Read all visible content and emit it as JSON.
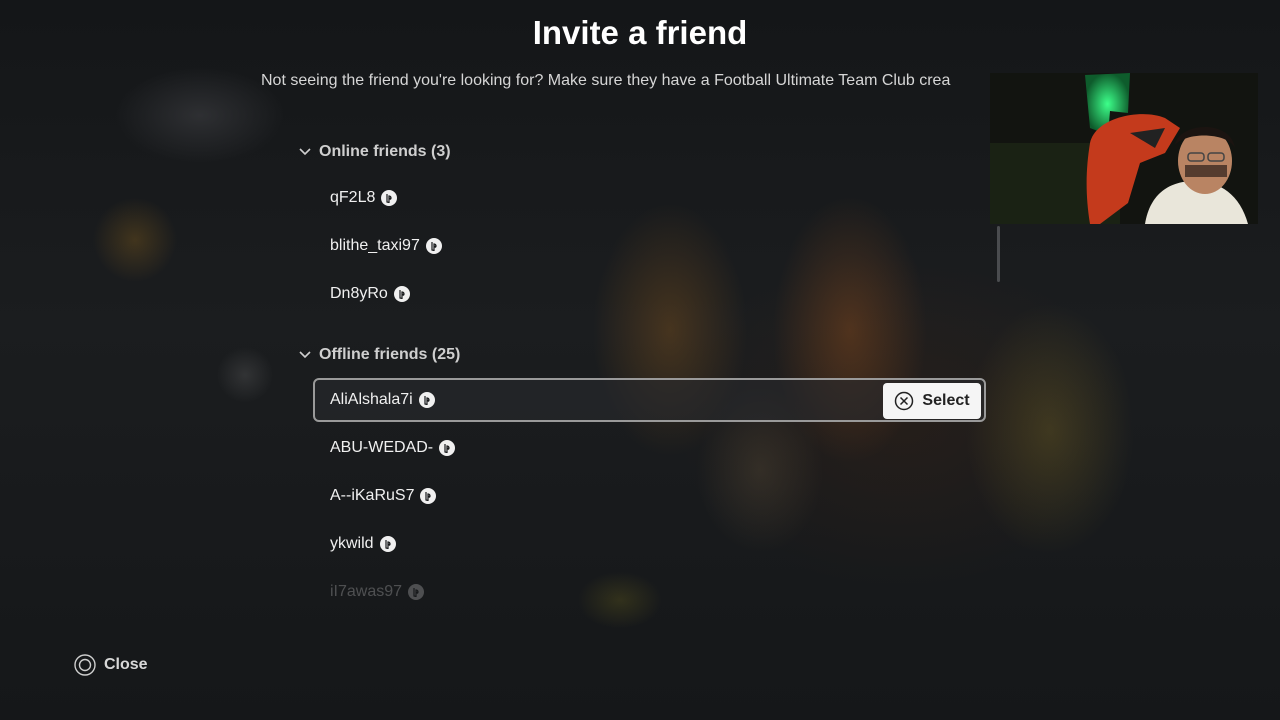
{
  "header": {
    "title": "Invite a friend",
    "subtitle": "Not seeing the friend you're looking for? Make sure they have a Football Ultimate Team Club crea"
  },
  "online": {
    "label": "Online friends (3)",
    "friends": [
      "qF2L8",
      "blithe_taxi97",
      "Dn8yRo"
    ]
  },
  "offline": {
    "label": "Offline friends (25)",
    "friends": [
      "AliAlshala7i",
      "ABU-WEDAD-",
      "A--iKaRuS7",
      "ykwild",
      "iI7awas97"
    ],
    "focused_index": 0
  },
  "actions": {
    "select_label": "Select",
    "close_label": "Close"
  },
  "icons": {
    "platform": "playstation-icon",
    "select": "cross-button-icon",
    "close": "circle-button-icon",
    "section_toggle": "chevron-down-icon"
  },
  "colors": {
    "select_button_bg": "#f5f5f5",
    "focus_border": "#9a9a9a"
  }
}
